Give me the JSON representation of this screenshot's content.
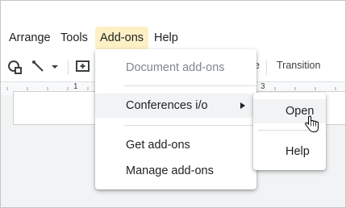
{
  "menubar": {
    "items": [
      {
        "label": "Arrange"
      },
      {
        "label": "Tools"
      },
      {
        "label": "Add-ons"
      },
      {
        "label": "Help"
      }
    ]
  },
  "toolbar": {
    "partial_label": "e",
    "transition_label": "Transition"
  },
  "ruler": {
    "numbers": [
      "1",
      "3"
    ]
  },
  "addons_menu": {
    "items": [
      {
        "label": "Document add-ons",
        "disabled": true
      },
      {
        "label": "Conferences i/o",
        "has_submenu": true
      },
      {
        "label": "Get add-ons"
      },
      {
        "label": "Manage add-ons"
      }
    ]
  },
  "submenu": {
    "items": [
      {
        "label": "Open"
      },
      {
        "label": "Help"
      }
    ]
  },
  "colors": {
    "active_menu_bg": "#fdf0c5",
    "hover_bg": "#f1f3f4",
    "disabled_text": "#80868b"
  }
}
